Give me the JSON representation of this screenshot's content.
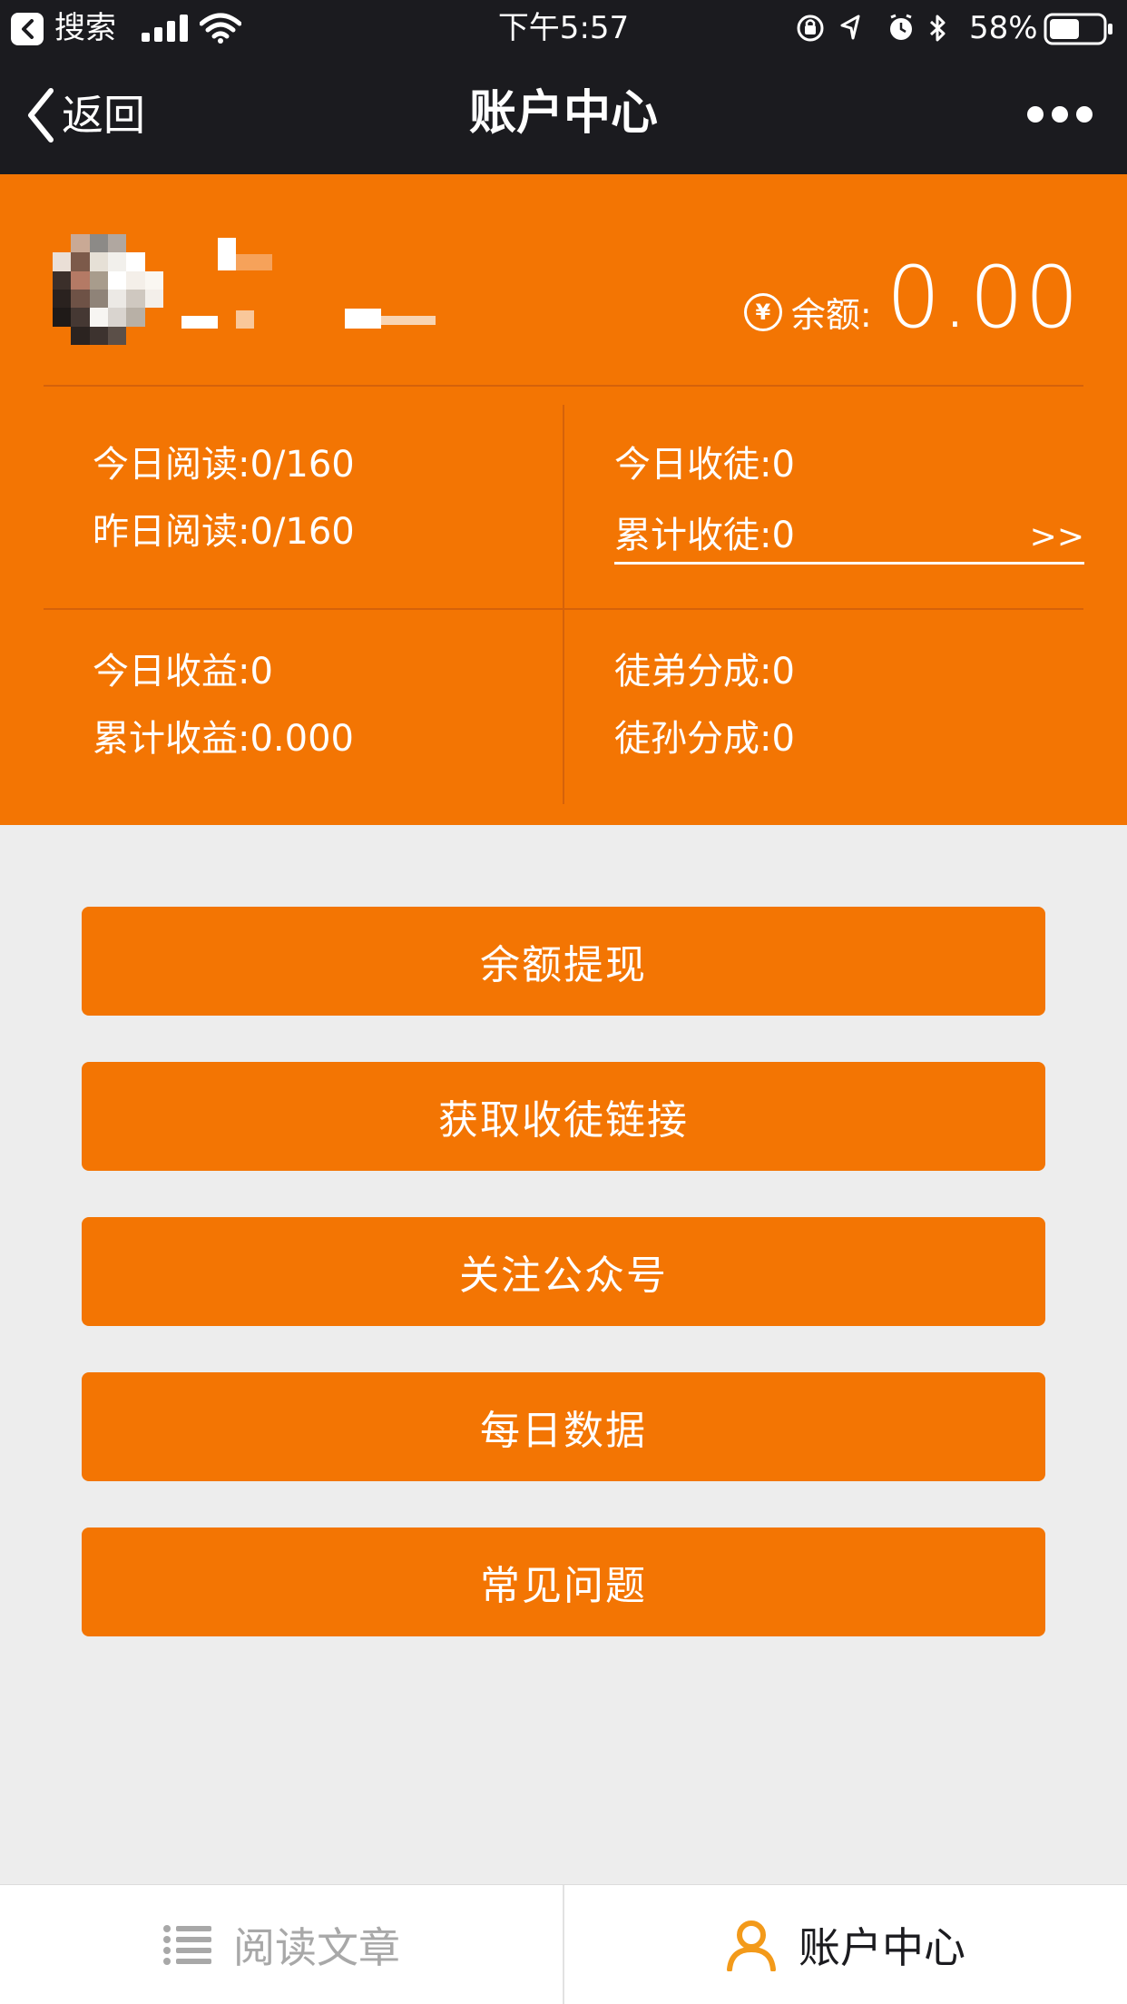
{
  "status_bar": {
    "back_app": "搜索",
    "time": "下午5:57",
    "battery": "58%",
    "battery_level": 0.58
  },
  "nav": {
    "back_label": "返回",
    "title": "账户中心"
  },
  "account": {
    "balance_label": "余额:",
    "balance_value": "0.00",
    "stats": {
      "today_read": "今日阅读:0/160",
      "yesterday_read": "昨日阅读:0/160",
      "today_followers": "今日收徒:0",
      "total_followers": "累计收徒:0",
      "more_arrow": ">>",
      "today_income": "今日收益:0",
      "total_income": "累计收益:0.000",
      "disciple_share": "徒弟分成:0",
      "grand_disciple_share": "徒孙分成:0"
    }
  },
  "buttons": {
    "withdraw": "余额提现",
    "invite_link": "获取收徒链接",
    "follow_account": "关注公众号",
    "daily_data": "每日数据",
    "faq": "常见问题"
  },
  "tabs": {
    "read": "阅读文章",
    "account": "账户中心"
  },
  "colors": {
    "accent": "#f37503",
    "bar": "#1b1b1f",
    "background": "#ededed",
    "tab_active_icon": "#f39a1a",
    "tab_inactive": "#a8a8a8"
  }
}
